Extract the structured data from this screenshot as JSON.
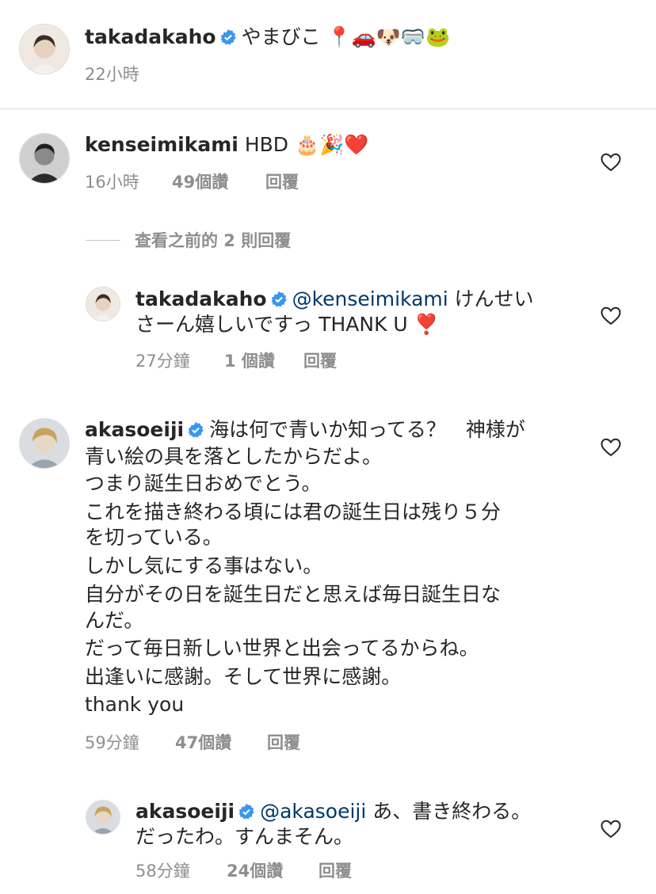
{
  "caption": {
    "username": "takadakaho",
    "text": "やまびこ 📍🚗🐶🥽🐸",
    "time": "22小時"
  },
  "comments": [
    {
      "username": "kenseimikami",
      "lines": [
        "HBD 🎂🎉❤️"
      ],
      "time": "16小時",
      "likes": "49個讚",
      "reply": "回覆"
    },
    {
      "username": "akasoeiji",
      "lines": [
        "海は何で青いか知ってる？　神様が",
        "青い絵の具を落としたからだよ。",
        "つまり誕生日おめでとう。",
        "これを描き終わる頃には君の誕生日は残り５分",
        "を切っている。",
        "しかし気にする事はない。",
        "自分がその日を誕生日だと思えば毎日誕生日な",
        "んだ。",
        "だって毎日新しい世界と出会ってるからね。",
        "出逢いに感謝。そして世界に感謝。",
        "thank you"
      ],
      "time": "59分鐘",
      "likes": "47個讚",
      "reply": "回覆"
    }
  ],
  "view_previous": "查看之前的 2 則回覆",
  "replies": [
    {
      "username": "takadakaho",
      "mention": "@kenseimikami",
      "line1_rest": "けんせい",
      "line2": "さーん嬉しいですっ THANK U ❣️",
      "time": "27分鐘",
      "likes": "1 個讚",
      "reply": "回覆"
    },
    {
      "username": "akasoeiji",
      "mention": "@akasoeiji",
      "line1_rest": "あ、書き終わる。",
      "line2": "だったわ。すんまそん。",
      "time": "58分鐘",
      "likes": "24個讚",
      "reply": "回覆"
    }
  ],
  "colors": {
    "text": "#262626",
    "muted": "#8e8e8e",
    "link": "#00376b",
    "verified": "#3897f0"
  }
}
